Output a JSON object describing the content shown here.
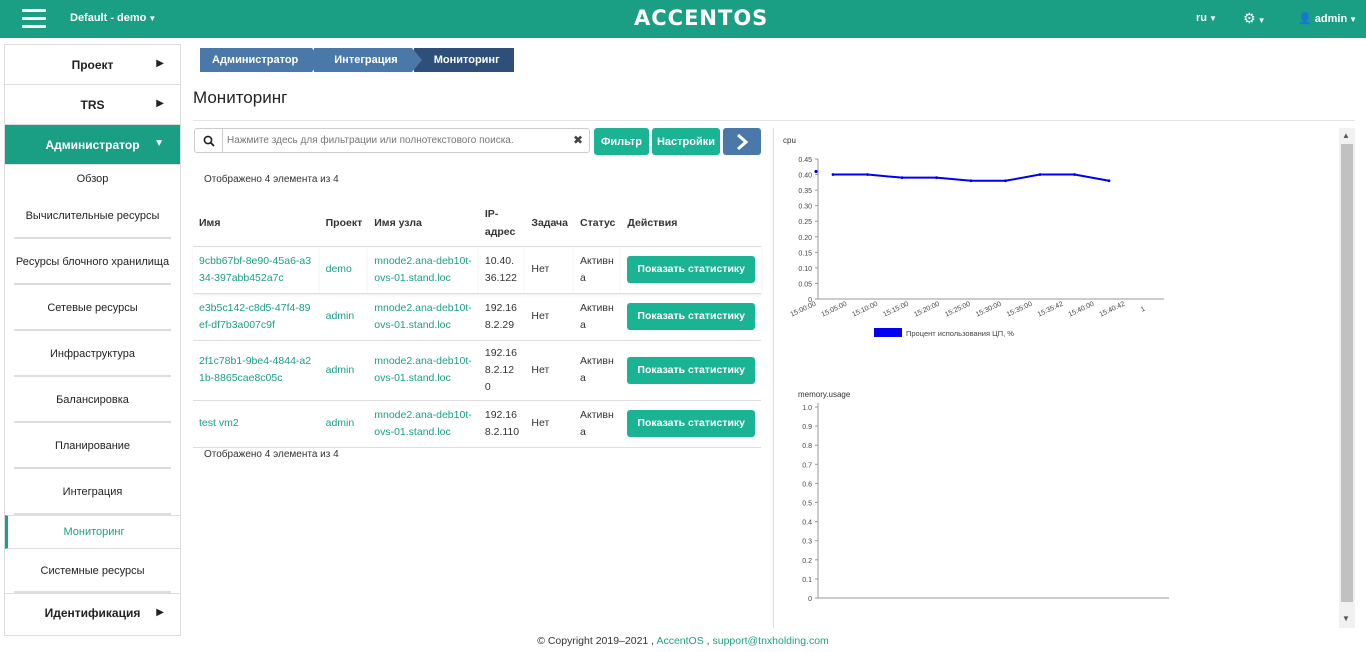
{
  "topbar": {
    "project": "Default - demo",
    "brand": "ACCENTOS",
    "lang": "ru",
    "user": "admin"
  },
  "sidebar": {
    "main": [
      {
        "label": "Проект"
      },
      {
        "label": "TRS"
      },
      {
        "label": "Администратор"
      }
    ],
    "sub": [
      {
        "label": "Обзор"
      },
      {
        "label": "Вычислительные ресурсы"
      },
      {
        "label": "Ресурсы блочного хранилища"
      },
      {
        "label": "Сетевые ресурсы"
      },
      {
        "label": "Инфраструктура"
      },
      {
        "label": "Балансировка"
      },
      {
        "label": "Планирование"
      },
      {
        "label": "Интеграция"
      },
      {
        "label": "Мониторинг"
      },
      {
        "label": "Системные ресурсы"
      }
    ],
    "bottom": {
      "label": "Идентификация"
    }
  },
  "breadcrumb": [
    "Администратор",
    "Интеграция",
    "Мониторинг"
  ],
  "page_title": "Мониторинг",
  "search": {
    "placeholder": "Нажмите здесь для фильтрации или полнотекстового поиска."
  },
  "buttons": {
    "filter": "Фильтр",
    "settings": "Настройки"
  },
  "count_text": "Отображено 4 элемента из 4",
  "table": {
    "headers": [
      "Имя",
      "Проект",
      "Имя узла",
      "IP-адрес",
      "Задача",
      "Статус",
      "Действия"
    ],
    "rows": [
      {
        "name": "9cbb67bf-8e90-45a6-a334-397abb452a7c",
        "project": "demo",
        "host": "mnode2.ana-deb10t-ovs-01.stand.loc",
        "ip": "10.40.36.122",
        "task": "Нет",
        "status": "Активна",
        "action": "Показать статистику"
      },
      {
        "name": "e3b5c142-c8d5-47f4-89ef-df7b3a007c9f",
        "project": "admin",
        "host": "mnode2.ana-deb10t-ovs-01.stand.loc",
        "ip": "192.168.2.29",
        "task": "Нет",
        "status": "Активна",
        "action": "Показать статистику"
      },
      {
        "name": "2f1c78b1-9be4-4844-a21b-8865cae8c05c",
        "project": "admin",
        "host": "mnode2.ana-deb10t-ovs-01.stand.loc",
        "ip": "192.168.2.120",
        "task": "Нет",
        "status": "Активна",
        "action": "Показать статистику"
      },
      {
        "name": "test vm2",
        "project": "admin",
        "host": "mnode2.ana-deb10t-ovs-01.stand.loc",
        "ip": "192.168.2.110",
        "task": "Нет",
        "status": "Активна",
        "action": "Показать статистику"
      }
    ]
  },
  "colors": {
    "accent": "#1a9f85",
    "breadcrumb": "#4a78a8",
    "series": "#0000ee"
  },
  "chart_data": [
    {
      "type": "line",
      "title": "cpu",
      "x": [
        "15:05:00",
        "15:10:00",
        "15:15:00",
        "15:20:00",
        "15:25:00",
        "15:30:00",
        "15:35:00",
        "15:35:42",
        "15:40:00"
      ],
      "x_ticks": [
        "15:00:00",
        "15:05:00",
        "15:10:00",
        "15:15:00",
        "15:20:00",
        "15:25:00",
        "15:30:00",
        "15:35:00",
        "15:35:42",
        "15:40:00",
        "15:40:42",
        "1"
      ],
      "series": [
        {
          "name": "Процент использования ЦП, %",
          "values": [
            0.4,
            0.4,
            0.39,
            0.39,
            0.38,
            0.38,
            0.4,
            0.4,
            0.38
          ]
        }
      ],
      "y_ticks": [
        "0.45",
        "0.40",
        "0.35",
        "0.30",
        "0.25",
        "0.20",
        "0.15",
        "0.10",
        "0.05",
        "0"
      ],
      "ylim": [
        0,
        0.45
      ],
      "legend": "bottom"
    },
    {
      "type": "line",
      "title": "memory.usage",
      "series": [],
      "y_ticks": [
        "1.0",
        "0.9",
        "0.8",
        "0.7",
        "0.6",
        "0.5",
        "0.4",
        "0.3",
        "0.2",
        "0.1",
        "0"
      ],
      "ylim": [
        0,
        1.0
      ]
    }
  ],
  "footer": {
    "copyright": "© Copyright 2019–2021 ,",
    "brand_link": "AccentOS",
    "sep": ",",
    "email": "support@tnxholding.com"
  }
}
